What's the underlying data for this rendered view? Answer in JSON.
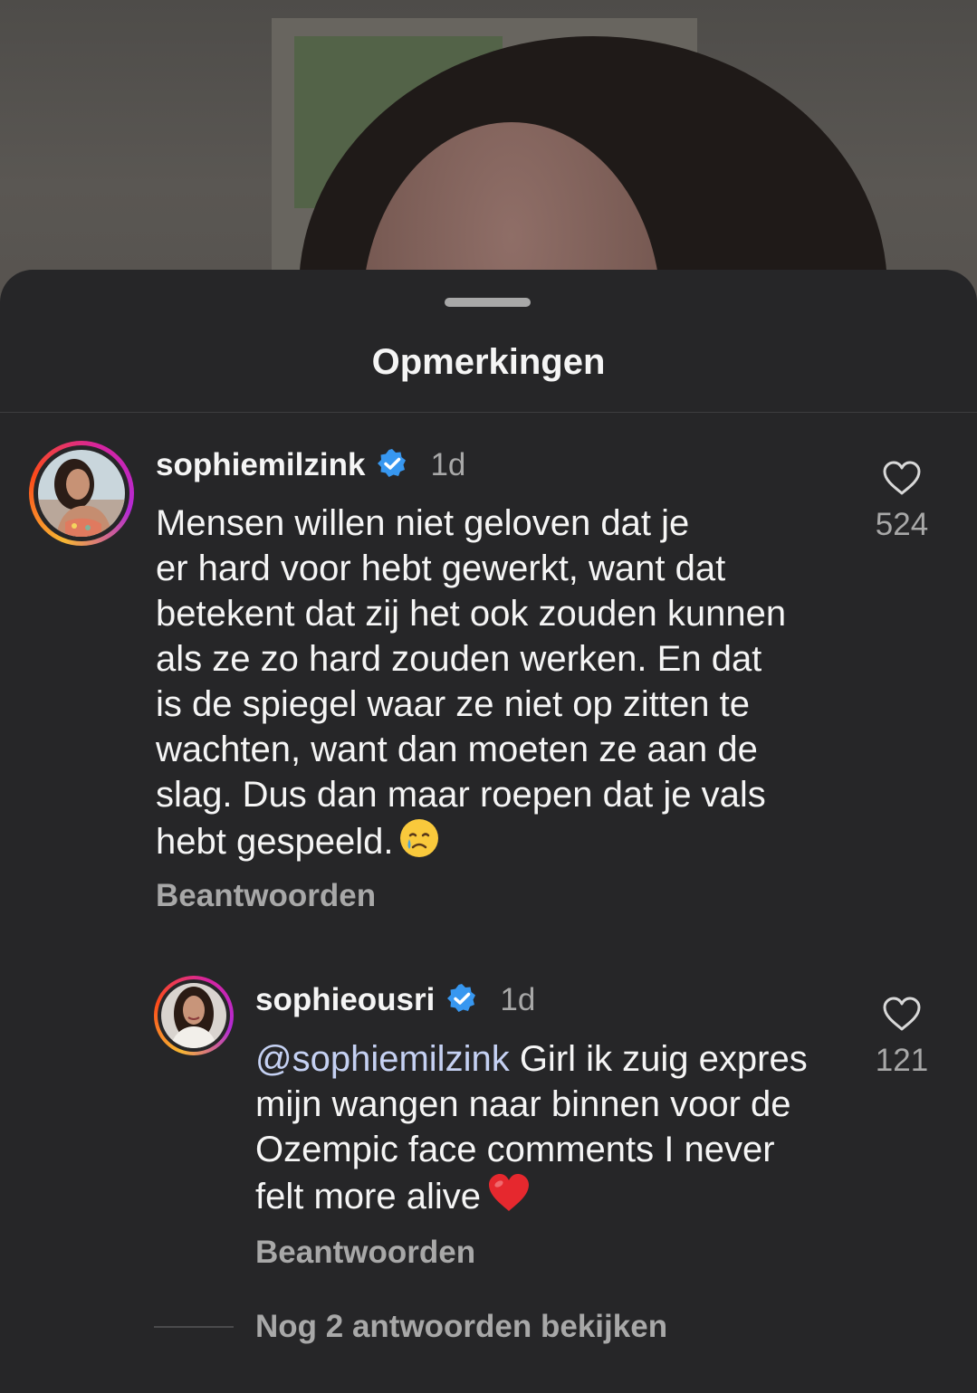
{
  "sheet": {
    "title": "Opmerkingen"
  },
  "comments": [
    {
      "username": "sophiemilzink",
      "verified": true,
      "time": "1d",
      "text_lines": [
        "Mensen willen niet geloven dat je",
        "er hard voor hebt gewerkt, want dat",
        "betekent dat zij het ook zouden kunnen",
        "als ze zo hard zouden werken. En dat",
        "is de spiegel waar ze niet op zitten te",
        "wachten, want dan moeten ze aan de",
        "slag. Dus dan maar roepen dat je vals",
        "hebt gespeeld."
      ],
      "emoji": "crying-face",
      "reply_label": "Beantwoorden",
      "likes": "524"
    },
    {
      "username": "sophieousri",
      "verified": true,
      "time": "1d",
      "mention": "@sophiemilzink",
      "text_lines": [
        " Girl ik zuig expres",
        "mijn wangen naar binnen voor de",
        "Ozempic face comments I never",
        "felt more alive"
      ],
      "emoji": "red-heart",
      "reply_label": "Beantwoorden",
      "likes": "121"
    }
  ],
  "view_more_replies": "Nog 2 antwoorden bekijken",
  "colors": {
    "sheet_bg": "#262628",
    "text": "#f5f5f5",
    "muted": "#a8a8a8",
    "verified": "#3797f0",
    "mention": "#c5d1f3"
  }
}
